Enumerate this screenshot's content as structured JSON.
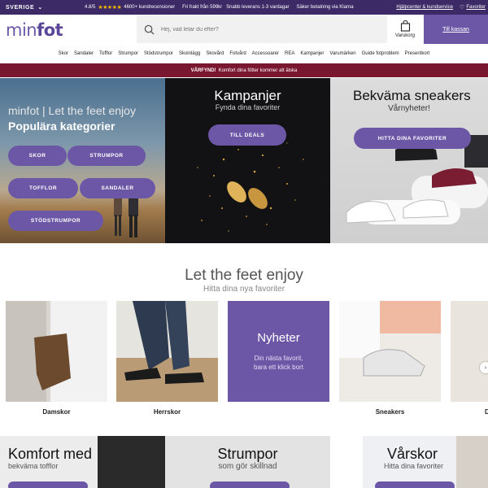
{
  "topbar": {
    "country": "SVERIGE",
    "rating": "4.8/5",
    "stars": "★★★★★",
    "reviews": "4600+ kundrecensioner",
    "shipping": "Fri frakt från 599kr",
    "delivery": "Snabb leverans 1-3 vardagar",
    "payment": "Säker betalning via Klarna",
    "help": "Hjälpcenter & kundservice",
    "favorites": "Favoriter"
  },
  "header": {
    "logo_light": "min",
    "logo_bold": "fot",
    "search_placeholder": "Hej, vad letar du efter?",
    "cart_label": "Varukorg",
    "login_label": "Till kassan"
  },
  "nav": {
    "items": [
      "Skor",
      "Sandaler",
      "Tofflor",
      "Strumpor",
      "Stödstrumpor",
      "Skoinlägg",
      "Skovård",
      "Fotvård",
      "Accessoarer",
      "REA",
      "Kampanjer",
      "Varumärken",
      "Guide fotproblem",
      "Presentkort"
    ]
  },
  "promo": {
    "bold": "VÅRFYND!",
    "text": "Komfort dina fötter kommer att älska"
  },
  "hero": {
    "categories": {
      "eyebrow": "minfot | Let the feet enjoy",
      "title": "Populära kategorier",
      "buttons": [
        "SKOR",
        "STRUMPOR",
        "TOFFLOR",
        "SANDALER",
        "STÖDSTRUMPOR"
      ]
    },
    "campaigns": {
      "title": "Kampanjer",
      "subtitle": "Fynda dina favoriter",
      "button": "TILL DEALS"
    },
    "sneakers": {
      "title": "Bekväma sneakers",
      "subtitle": "Vårnyheter!",
      "button": "HITTA DINA FAVORITER"
    }
  },
  "section": {
    "title": "Let the feet enjoy",
    "subtitle": "Hitta dina nya favoriter",
    "cards": [
      {
        "label": "Damskor"
      },
      {
        "label": "Herrskor"
      },
      {
        "label": "",
        "title": "Nyheter",
        "text": "Din nästa favorit,\nbara ett klick bort"
      },
      {
        "label": "Sneakers"
      },
      {
        "label": "D"
      }
    ]
  },
  "bottom": {
    "b1": {
      "title": "Komfort med",
      "subtitle": "bekväma tofflor"
    },
    "b2": {
      "title": "Strumpor",
      "subtitle": "som gör skillnad"
    },
    "b3": {
      "title": "Vårskor",
      "subtitle": "Hitta dina favoriter"
    }
  },
  "colors": {
    "purple": "#6c57a6",
    "topbar": "#3b2a66",
    "promo": "#7a1730"
  }
}
